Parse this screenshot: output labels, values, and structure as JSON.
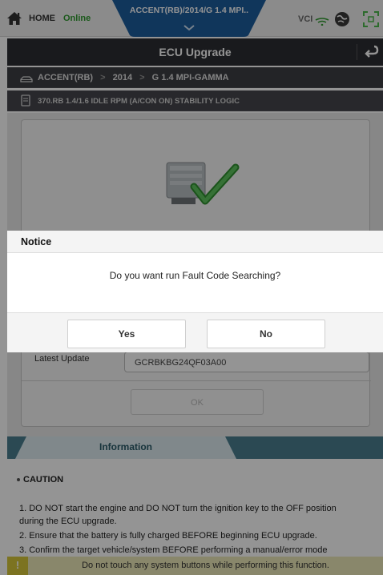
{
  "status_bar": {
    "home_label": "HOME",
    "connection_status": "Online",
    "vehicle_tab_title": "ACCENT(RB)/2014/G 1.4 MPI..",
    "vci_label": "VCI",
    "icons": [
      "home-icon",
      "vci-signal-icon",
      "globe-icon",
      "expand-icon",
      "chevron-down-icon"
    ]
  },
  "title_bar": {
    "title": "ECU Upgrade",
    "back_icon": "return-arrow-icon"
  },
  "breadcrumb": {
    "items": [
      "ACCENT(RB)",
      "2014",
      "G 1.4 MPI-GAMMA"
    ],
    "separator": ">",
    "ecu_logic": "370.RB 1.4/1.6 IDLE RPM (A/CON ON) STABILITY LOGIC"
  },
  "upgrade_panel": {
    "latest_update_label": "Latest Update",
    "latest_update_value": "GCRBKBG24QF03A00",
    "ok_label": "OK"
  },
  "information": {
    "tab_label": "Information",
    "caution_title": "CAUTION",
    "lines": [
      "1. DO NOT start the engine and DO NOT turn the ignition key to the OFF position",
      "during the ECU upgrade.",
      "2. Ensure that the battery is fully charged BEFORE beginning ECU upgrade.",
      "3. Confirm the target vehicle/system BEFORE performing a manual/error mode"
    ]
  },
  "warning_bar": {
    "icon": "!",
    "text": "Do not touch any system buttons while performing this function."
  },
  "dialog": {
    "title": "Notice",
    "message": "Do you want run Fault Code Searching?",
    "yes_label": "Yes",
    "no_label": "No"
  },
  "colors": {
    "title_bar": "#2c2d32",
    "vehicle_tab": "#1d5d9e",
    "online_green": "#2f9a2f",
    "info_teal": "#4a7f8f",
    "warning_yellow": "#d6c63a"
  }
}
